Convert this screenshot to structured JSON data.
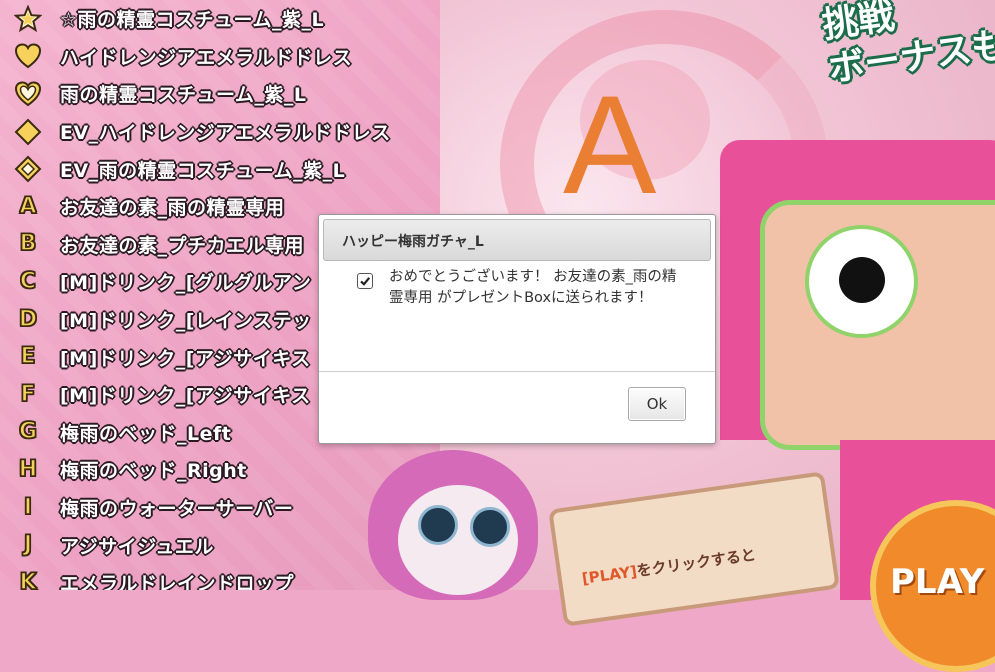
{
  "prize_list": [
    {
      "badge": "star-outline-icon",
      "name": "☆雨の精霊コスチューム_紫_L"
    },
    {
      "badge": "heart-filled-icon",
      "name": "ハイドレンジアエメラルドドレス"
    },
    {
      "badge": "heart-outline-icon",
      "name": "雨の精霊コスチューム_紫_L"
    },
    {
      "badge": "diamond-filled-icon",
      "name": "EV_ハイドレンジアエメラルドドレス"
    },
    {
      "badge": "diamond-outline-icon",
      "name": "EV_雨の精霊コスチューム_紫_L"
    },
    {
      "letter": "A",
      "name": "お友達の素_雨の精霊専用"
    },
    {
      "letter": "B",
      "name": "お友達の素_プチカエル専用"
    },
    {
      "letter": "C",
      "name": "[M]ドリンク_[グルグルアン"
    },
    {
      "letter": "D",
      "name": "[M]ドリンク_[レインステッ"
    },
    {
      "letter": "E",
      "name": "[M]ドリンク_[アジサイキス"
    },
    {
      "letter": "F",
      "name": "[M]ドリンク_[アジサイキス"
    },
    {
      "letter": "G",
      "name": "梅雨のベッド_Left"
    },
    {
      "letter": "H",
      "name": "梅雨のベッド_Right"
    },
    {
      "letter": "I",
      "name": "梅雨のウォーターサーバー"
    },
    {
      "letter": "J",
      "name": "アジサイジュエル"
    },
    {
      "letter": "K",
      "name": "エメラルドレインドロップ"
    }
  ],
  "scene": {
    "banner_text_line1": "挑戦",
    "banner_text_line2": "ボーナスも",
    "result_letter": "A",
    "play_label": "PLAY",
    "sign_highlight": "[PLAY]",
    "sign_text": "をクリックすると"
  },
  "dialog": {
    "title": "ハッピー梅雨ガチャ_L",
    "message": "おめでとうございます！ お友達の素_雨の精霊専用 がプレゼントBoxに送られます！",
    "ok_label": "Ok"
  },
  "colors": {
    "panel_pink": "#eea3c4",
    "badge_gold": "#f6d25d",
    "result_orange": "#ea7f33",
    "machine_pink": "#e8509a",
    "monster_green": "#8fd36a"
  }
}
